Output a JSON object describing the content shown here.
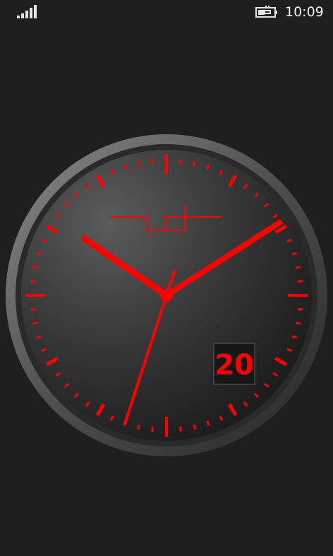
{
  "status_bar": {
    "signal_icon": "signal-strength-icon",
    "battery_icon": "battery-charging-icon",
    "time": "10:09"
  },
  "clock": {
    "day": "20",
    "hands": {
      "hour": "10",
      "minute": "9",
      "second": "33"
    },
    "icons": {
      "logo": "brand-logo-icon"
    },
    "colors": {
      "background": "#1f1f1f",
      "face": "#3a3a3a",
      "rim": "#616161",
      "accent": "#ff0000"
    }
  }
}
